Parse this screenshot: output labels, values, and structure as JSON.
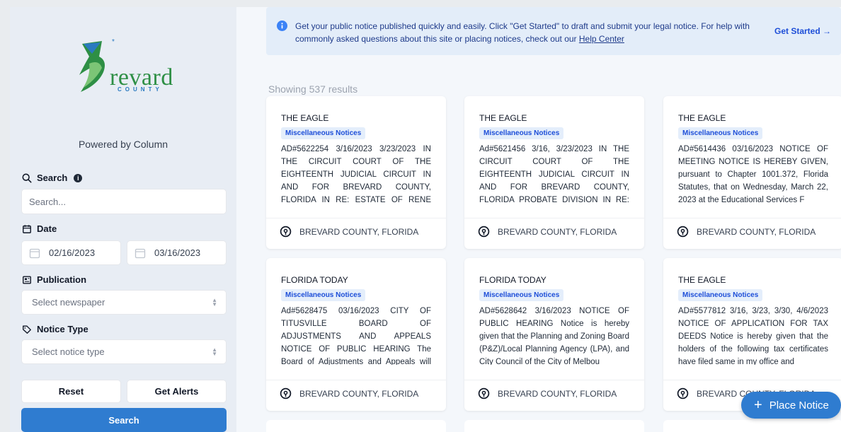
{
  "sidebar": {
    "logo_text": "revard",
    "logo_subtext": "COUNTY",
    "powered_by": "Powered by Column",
    "search_label": "Search",
    "search_placeholder": "Search...",
    "date_label": "Date",
    "date_from": "02/16/2023",
    "date_to": "03/16/2023",
    "publication_label": "Publication",
    "publication_value": "Select newspaper",
    "notice_type_label": "Notice Type",
    "notice_type_value": "Select notice type",
    "reset_label": "Reset",
    "alerts_label": "Get Alerts",
    "search_button_label": "Search"
  },
  "banner": {
    "text": "Get your public notice published quickly and easily. Click \"Get Started\" to draft and submit your legal notice. For help with commonly asked questions about this site or placing notices, check out our",
    "link": "Help Center",
    "cta": "Get Started →"
  },
  "results": {
    "count_text": "Showing 537 results",
    "cards": [
      {
        "publication": "THE EAGLE",
        "category": "Miscellaneous Notices",
        "text": "AD#5622254 3/16/2023 3/23/2023 IN THE CIRCUIT COURT OF THE EIGHTEENTH JUDICIAL CIRCUIT IN AND FOR BREVARD COUNTY, FLORIDA IN RE: ESTATE OF RENE JEAN BENOIT, De",
        "location": "BREVARD COUNTY, FLORIDA"
      },
      {
        "publication": "THE EAGLE",
        "category": "Miscellaneous Notices",
        "text": "Ad#5621456 3/16, 3/23/2023 IN THE CIRCUIT COURT OF THE EIGHTEENTH JUDICIAL CIRCUIT IN AND FOR BREVARD COUNTY, FLORIDA PROBATE DIVISION IN RE: ESTATE OF RICHARD",
        "location": "BREVARD COUNTY, FLORIDA"
      },
      {
        "publication": "THE EAGLE",
        "category": "Miscellaneous Notices",
        "text": "AD#5614436 03/16/2023 NOTICE OF MEETING NOTICE IS HEREBY GIVEN, pursuant to Chapter 1001.372, Florida Statutes, that on Wednesday, March 22, 2023 at the Educational Services F",
        "location": "BREVARD COUNTY, FLORIDA"
      },
      {
        "publication": "FLORIDA TODAY",
        "category": "Miscellaneous Notices",
        "text": "Ad#5628475 03/16/2023 CITY OF TITUSVILLE BOARD OF ADJUSTMENTS AND APPEALS NOTICE OF PUBLIC HEARING The Board of Adjustments and Appeals will hold a public hearing o",
        "location": "BREVARD COUNTY, FLORIDA"
      },
      {
        "publication": "FLORIDA TODAY",
        "category": "Miscellaneous Notices",
        "text": "AD#5628642 3/16/2023 NOTICE OF PUBLIC HEARING Notice is hereby given that the Planning and Zoning Board (P&Z)/Local Planning Agency (LPA), and City Council of the City of Melbou",
        "location": "BREVARD COUNTY, FLORIDA"
      },
      {
        "publication": "THE EAGLE",
        "category": "Miscellaneous Notices",
        "text": "AD#5577812 3/16, 3/23, 3/30, 4/6/2023 NOTICE OF APPLICATION FOR TAX DEEDS Notice is hereby given that the holders of the following tax certificates have filed same in my office and",
        "location": "BREVARD COUNTY, FLORIDA"
      }
    ]
  },
  "fab": {
    "label": "Place Notice"
  },
  "colors": {
    "primary": "#2f7cd0",
    "badge_bg": "#e4eefb",
    "logo_green": "#2e8f45"
  }
}
